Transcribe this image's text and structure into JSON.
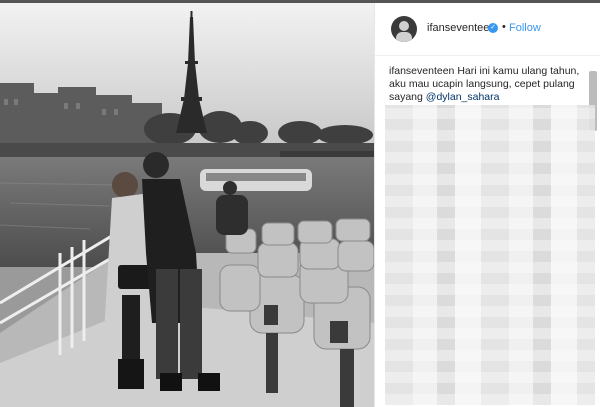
{
  "post": {
    "username": "ifanseventeen",
    "verified_icon": "verified-badge-icon",
    "separator": "•",
    "follow_label": "Follow",
    "caption_user": "ifanseventeen",
    "caption_text": "Hari ini kamu ulang tahun, aku mau ucapin langsung, cepet pulang sayang",
    "mention": "@dylan_sahara"
  },
  "colors": {
    "accent": "#3897f0",
    "mention": "#003569",
    "text": "#262626"
  }
}
